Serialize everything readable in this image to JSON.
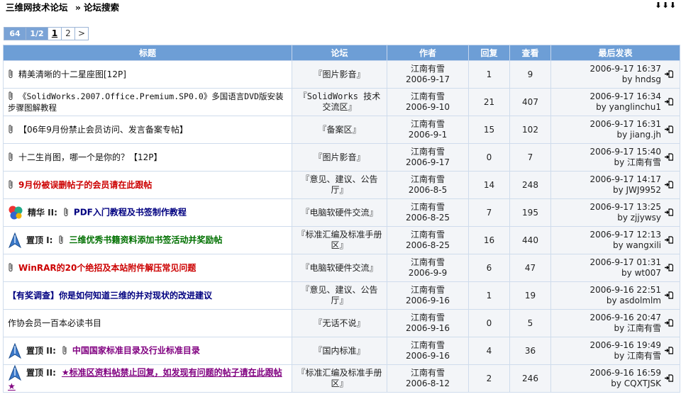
{
  "breadcrumb": {
    "forum": "三维网技术论坛",
    "separator": "»",
    "page": "论坛搜索",
    "jump": "⬇⬇⬇"
  },
  "pager": {
    "total": "64",
    "pages": "1/2",
    "current": "1",
    "next_page": "2",
    "next_arrow": ">"
  },
  "columns": {
    "title": "标题",
    "forum": "论坛",
    "author": "作者",
    "replies": "回复",
    "views": "查看",
    "last_post": "最后发表"
  },
  "rows": [
    {
      "title": "精美清晰的十二星座图[12P]",
      "forum": "『图片影音』",
      "author": "江南有雪",
      "date": "2006-9-17",
      "replies": "1",
      "views": "9",
      "last_time": "2006-9-17 16:37",
      "last_by": "by hndsg"
    },
    {
      "title": "《SolidWorks.2007.Office.Premium.SP0.0》多国语言DVD版安装步骤图解教程",
      "forum": "『SolidWorks 技术交流区』",
      "author": "江南有雪",
      "date": "2006-9-10",
      "replies": "21",
      "views": "407",
      "last_time": "2006-9-17 16:34",
      "last_by": "by yanglinchu1"
    },
    {
      "title": "【06年9月份禁止会员访问、发言备案专帖】",
      "forum": "『备案区』",
      "author": "江南有雪",
      "date": "2006-9-1",
      "replies": "15",
      "views": "102",
      "last_time": "2006-9-17 16:31",
      "last_by": "by jiang.jh"
    },
    {
      "title": "十二生肖图，哪一个是你的？【12P】",
      "forum": "『图片影音』",
      "author": "江南有雪",
      "date": "2006-9-17",
      "replies": "0",
      "views": "7",
      "last_time": "2006-9-17 15:40",
      "last_by": "by 江南有雪"
    },
    {
      "title": "9月份被误删帖子的会员请在此跟帖",
      "forum": "『意见、建议、公告厅』",
      "author": "江南有雪",
      "date": "2006-8-5",
      "replies": "14",
      "views": "248",
      "last_time": "2006-9-17 14:17",
      "last_by": "by JWJ9952"
    },
    {
      "tag": "精华 II:",
      "title": "PDF入门教程及书签制作教程",
      "forum": "『电脑软硬件交流』",
      "author": "江南有雪",
      "date": "2006-8-25",
      "replies": "7",
      "views": "195",
      "last_time": "2006-9-17 13:25",
      "last_by": "by zjjywsy"
    },
    {
      "tag": "置顶 I:",
      "title": "三维优秀书籍资料添加书签活动并奖励帖",
      "forum": "『标准汇编及标准手册区』",
      "author": "江南有雪",
      "date": "2006-8-25",
      "replies": "16",
      "views": "440",
      "last_time": "2006-9-17 12:13",
      "last_by": "by wangxili"
    },
    {
      "title": "WinRAR的20个绝招及本站附件解压常见问题",
      "forum": "『电脑软硬件交流』",
      "author": "江南有雪",
      "date": "2006-9-9",
      "replies": "6",
      "views": "47",
      "last_time": "2006-9-17 01:31",
      "last_by": "by wt007"
    },
    {
      "title": "【有奖调查】你是如何知道三维的并对现状的改进建议",
      "forum": "『意见、建议、公告厅』",
      "author": "江南有雪",
      "date": "2006-9-16",
      "replies": "1",
      "views": "19",
      "last_time": "2006-9-16 22:51",
      "last_by": "by asdolmlm"
    },
    {
      "title": "作协会员一百本必读书目",
      "forum": "『无话不说』",
      "author": "江南有雪",
      "date": "2006-9-16",
      "replies": "0",
      "views": "5",
      "last_time": "2006-9-16 20:47",
      "last_by": "by 江南有雪"
    },
    {
      "tag": "置顶 II:",
      "title": "中国国家标准目录及行业标准目录",
      "forum": "『国内标准』",
      "author": "江南有雪",
      "date": "2006-9-16",
      "replies": "4",
      "views": "36",
      "last_time": "2006-9-16 19:49",
      "last_by": "by 江南有雪"
    },
    {
      "tag": "置顶 II:",
      "title": "★标准区资料帖禁止回复，如发现有问题的帖子请在此跟帖★",
      "forum": "『标准汇编及标准手册区』",
      "author": "江南有雪",
      "date": "2006-8-12",
      "replies": "2",
      "views": "246",
      "last_time": "2006-9-16 16:59",
      "last_by": "by CQXTJSK"
    }
  ],
  "icons": {
    "attachment": "paperclip-icon",
    "jump_to_last": "go-last-post-icon",
    "digest": "digest-icon",
    "sticky": "sticky-icon"
  },
  "colors": {
    "header_bg": "#6d9ed6",
    "red_title": "#cc0000",
    "navy_title": "#000080",
    "green_title": "#007000",
    "purple_title": "#800080"
  }
}
